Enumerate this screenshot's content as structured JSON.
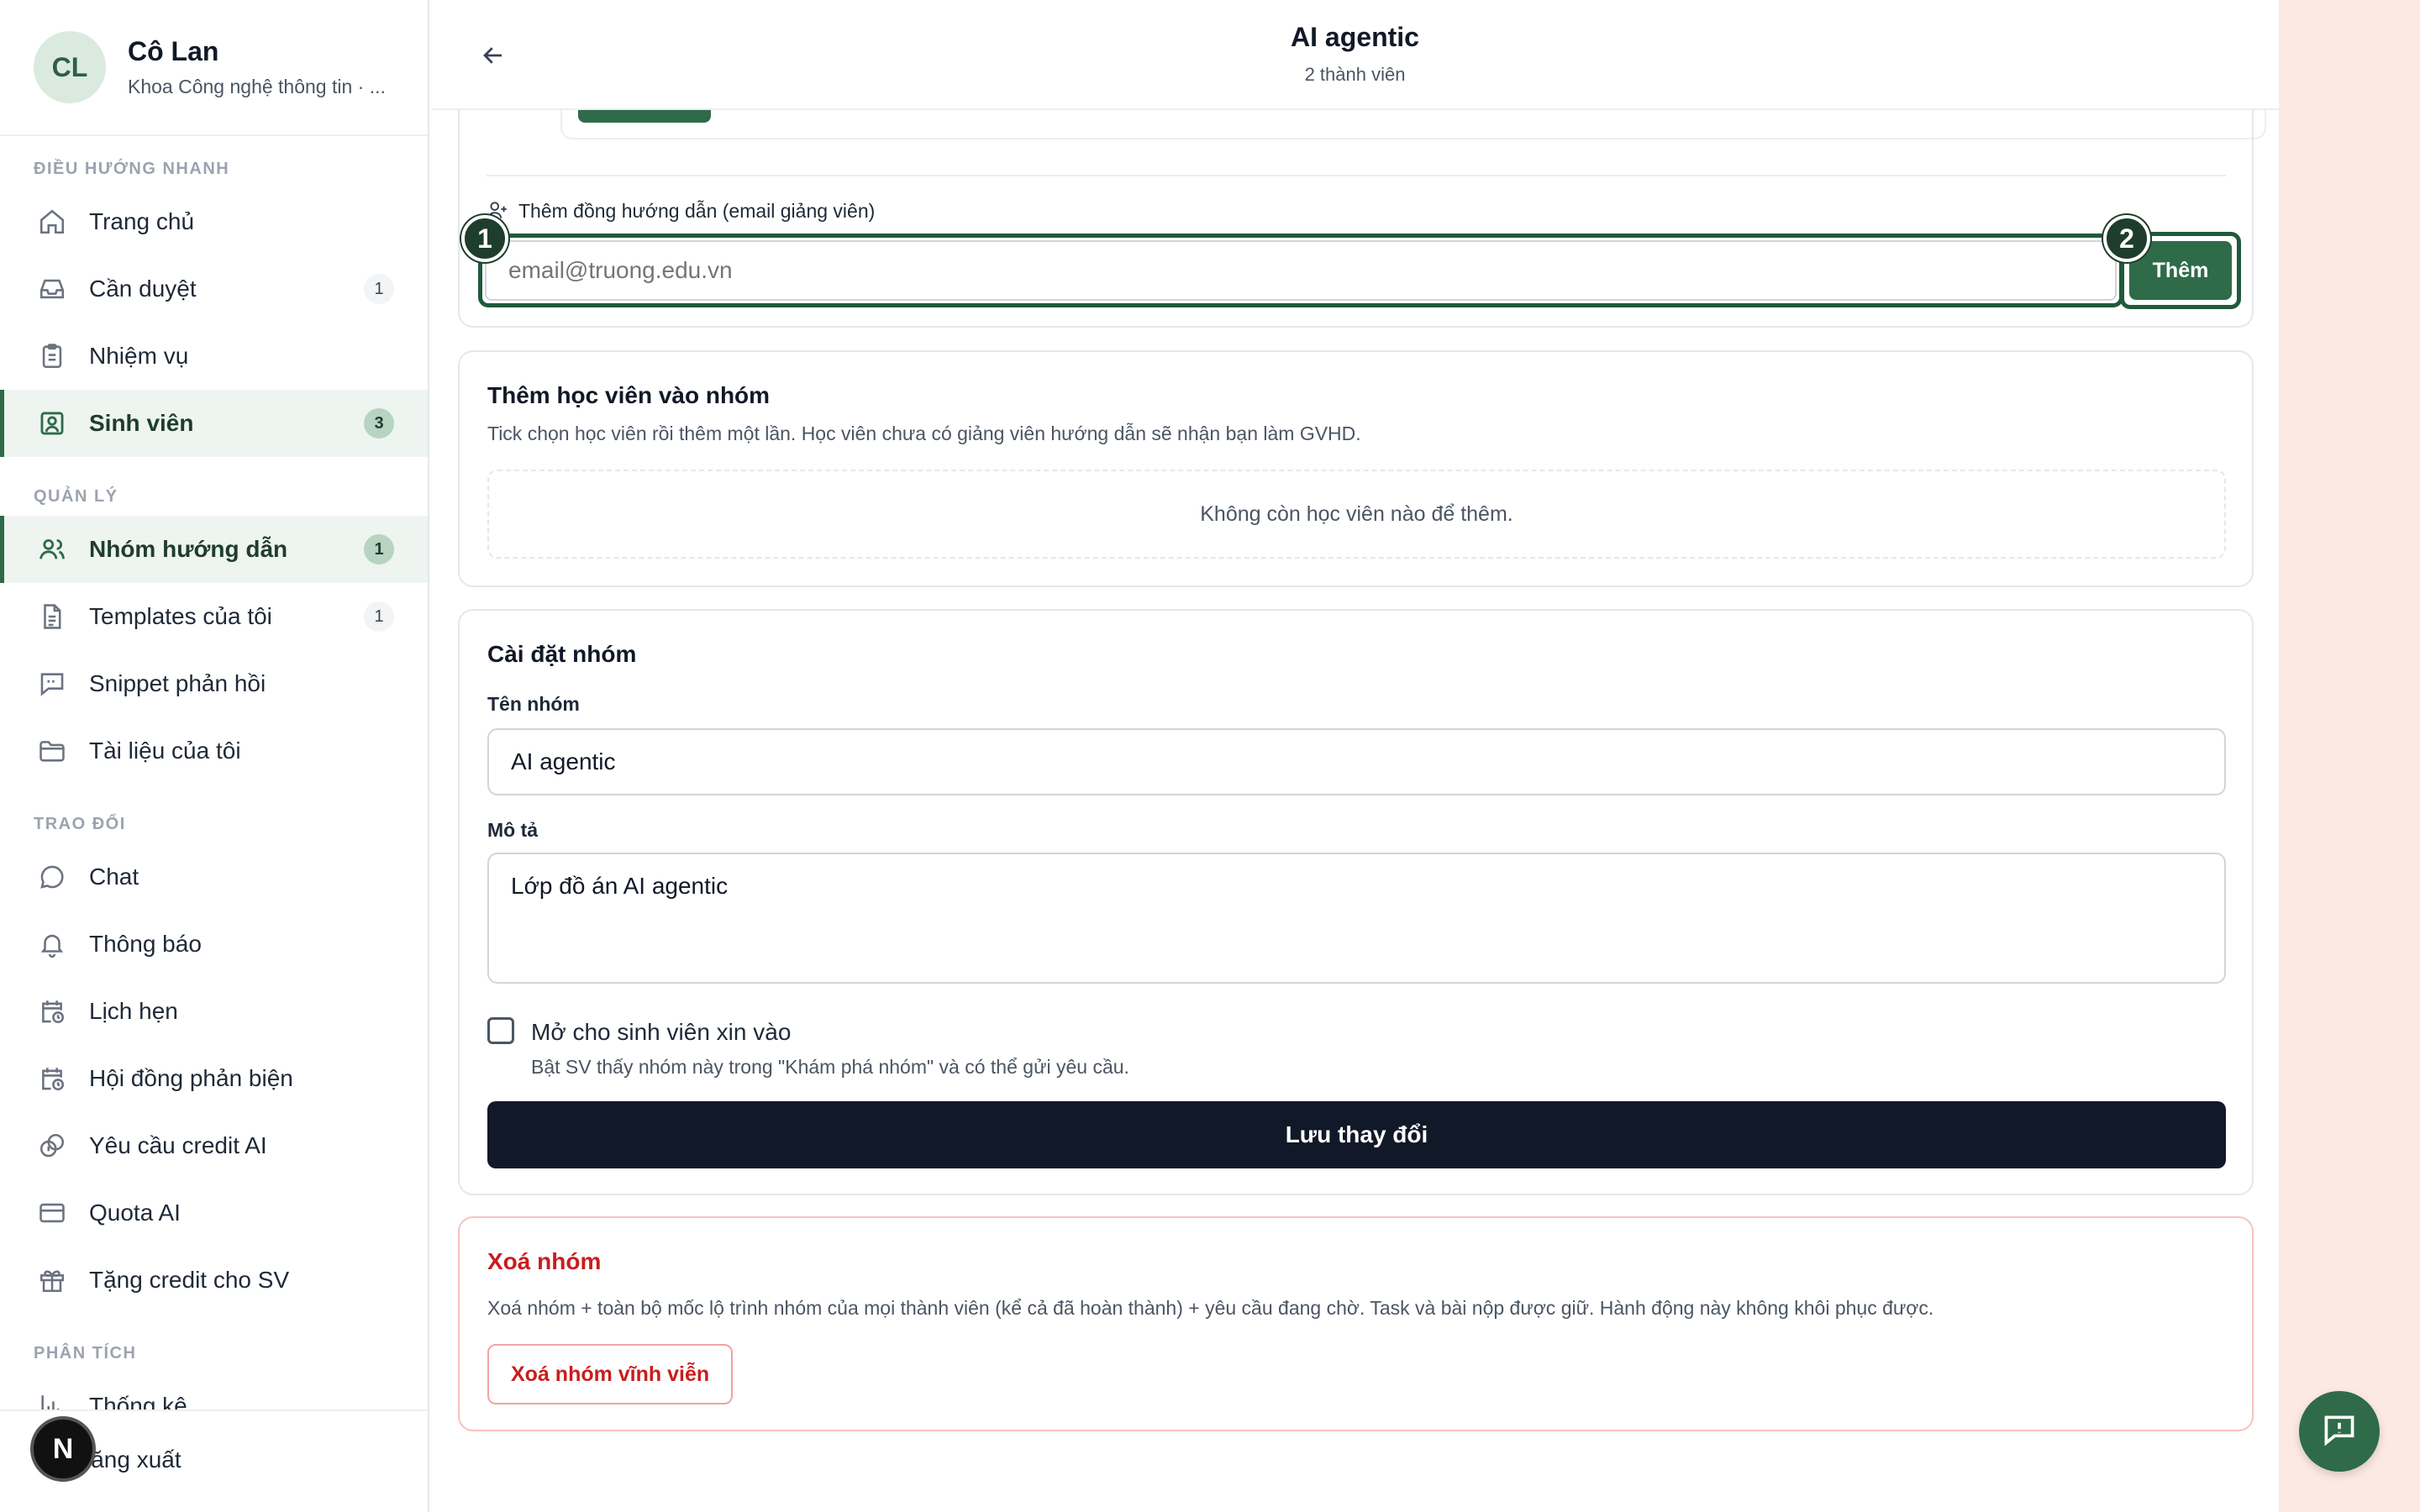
{
  "profile": {
    "initials": "CL",
    "name": "Cô Lan",
    "subtitle": "Khoa Công nghệ thông tin · ..."
  },
  "sections": {
    "quick_nav": "ĐIỀU HƯỚNG NHANH",
    "manage": "QUẢN LÝ",
    "exchange": "TRAO ĐỔI",
    "analytics": "PHÂN TÍCH"
  },
  "nav": {
    "home": "Trang chủ",
    "review": "Cần duyệt",
    "review_badge": "1",
    "tasks": "Nhiệm vụ",
    "students": "Sinh viên",
    "students_badge": "3",
    "groups": "Nhóm hướng dẫn",
    "groups_badge": "1",
    "templates": "Templates của tôi",
    "templates_badge": "1",
    "snippets": "Snippet phản hồi",
    "documents": "Tài liệu của tôi",
    "chat": "Chat",
    "notifications": "Thông báo",
    "appointments": "Lịch hẹn",
    "committee": "Hội đồng phản biện",
    "credit_request": "Yêu cầu credit AI",
    "quota": "Quota AI",
    "gift_credit": "Tặng credit cho SV",
    "stats": "Thống kê",
    "logout": "Đăng xuất",
    "n_badge": "N"
  },
  "header": {
    "title": "AI agentic",
    "subtitle": "2 thành viên"
  },
  "co_advisor": {
    "label": "Thêm đồng hướng dẫn (email giảng viên)",
    "placeholder": "email@truong.edu.vn",
    "add_button": "Thêm",
    "step1": "1",
    "step2": "2"
  },
  "add_students": {
    "title": "Thêm học viên vào nhóm",
    "description": "Tick chọn học viên rồi thêm một lần. Học viên chưa có giảng viên hướng dẫn sẽ nhận bạn làm GVHD.",
    "empty": "Không còn học viên nào để thêm."
  },
  "settings": {
    "title": "Cài đặt nhóm",
    "name_label": "Tên nhóm",
    "name_value": "AI agentic",
    "desc_label": "Mô tả",
    "desc_value": "Lớp đồ án AI agentic",
    "open_label": "Mở cho sinh viên xin vào",
    "open_hint": "Bật SV thấy nhóm này trong \"Khám phá nhóm\" và có thể gửi yêu cầu.",
    "save_button": "Lưu thay đổi"
  },
  "danger": {
    "title": "Xoá nhóm",
    "description": "Xoá nhóm + toàn bộ mốc lộ trình nhóm của mọi thành viên (kể cả đã hoàn thành) + yêu cầu đang chờ. Task và bài nộp được giữ. Hành động này không khôi phục được.",
    "delete_button": "Xoá nhóm vĩnh viễn"
  },
  "colors": {
    "accent": "#2f6b48",
    "danger": "#c81e1e",
    "dark_button": "#111827"
  }
}
